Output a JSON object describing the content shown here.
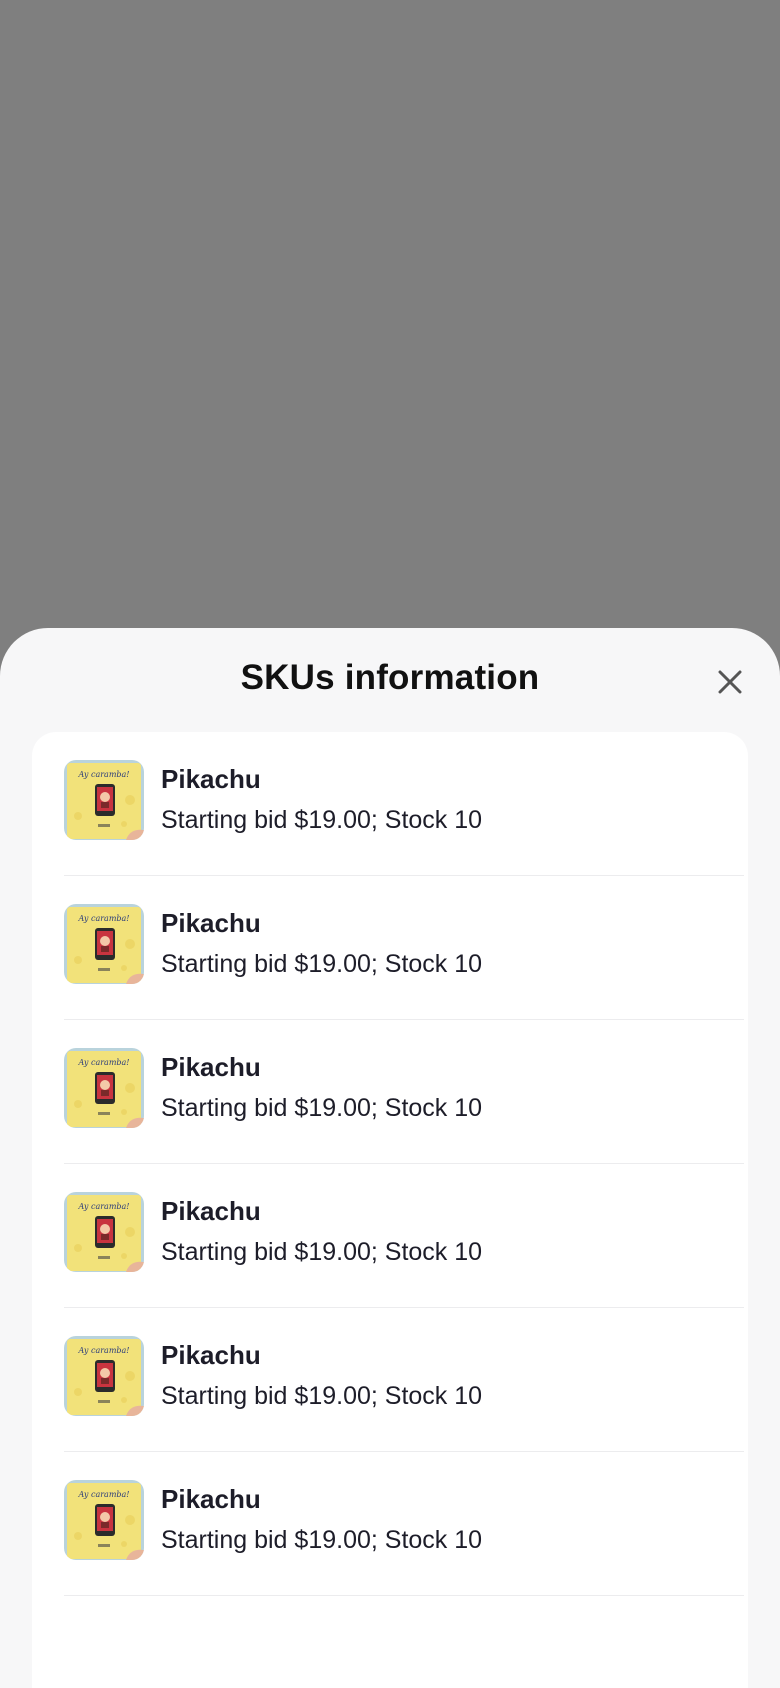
{
  "sheet": {
    "title": "SKUs information",
    "close_icon": "close-icon"
  },
  "skus": [
    {
      "name": "Pikachu",
      "detail": "Starting bid $19.00; Stock 10",
      "thumb_text": "Ay caramba!"
    },
    {
      "name": "Pikachu",
      "detail": "Starting bid $19.00; Stock 10",
      "thumb_text": "Ay caramba!"
    },
    {
      "name": "Pikachu",
      "detail": "Starting bid $19.00; Stock 10",
      "thumb_text": "Ay caramba!"
    },
    {
      "name": "Pikachu",
      "detail": "Starting bid $19.00; Stock 10",
      "thumb_text": "Ay caramba!"
    },
    {
      "name": "Pikachu",
      "detail": "Starting bid $19.00; Stock 10",
      "thumb_text": "Ay caramba!"
    },
    {
      "name": "Pikachu",
      "detail": "Starting bid $19.00; Stock 10",
      "thumb_text": "Ay caramba!"
    }
  ],
  "colors": {
    "backdrop": "#7f7f7f",
    "sheet": "#f7f7f8",
    "card": "#ffffff",
    "text": "#1d1d29",
    "thumb_yellow": "#f2e27a"
  }
}
